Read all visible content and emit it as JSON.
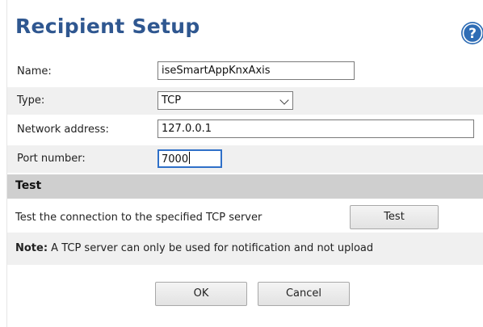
{
  "dialog": {
    "title": "Recipient Setup",
    "help_icon": "question-mark-circle-icon"
  },
  "form": {
    "name_label": "Name:",
    "name_value": "iseSmartAppKnxAxis",
    "type_label": "Type:",
    "type_value": "TCP",
    "network_label": "Network address:",
    "network_value": "127.0.0.1",
    "port_label": "Port number:",
    "port_value": "7000"
  },
  "test": {
    "header": "Test",
    "description": "Test the connection to the specified TCP server",
    "button_label": "Test"
  },
  "note": {
    "prefix": "Note:",
    "text": " A TCP server can only be used for notification and not upload"
  },
  "buttons": {
    "ok_label": "OK",
    "cancel_label": "Cancel"
  },
  "colors": {
    "title": "#2f5790",
    "help_icon": "#2f6db5",
    "section_header_bg": "#cfcfcf",
    "row_shade": "#f0f0f0",
    "focus_border": "#2f70c8"
  }
}
